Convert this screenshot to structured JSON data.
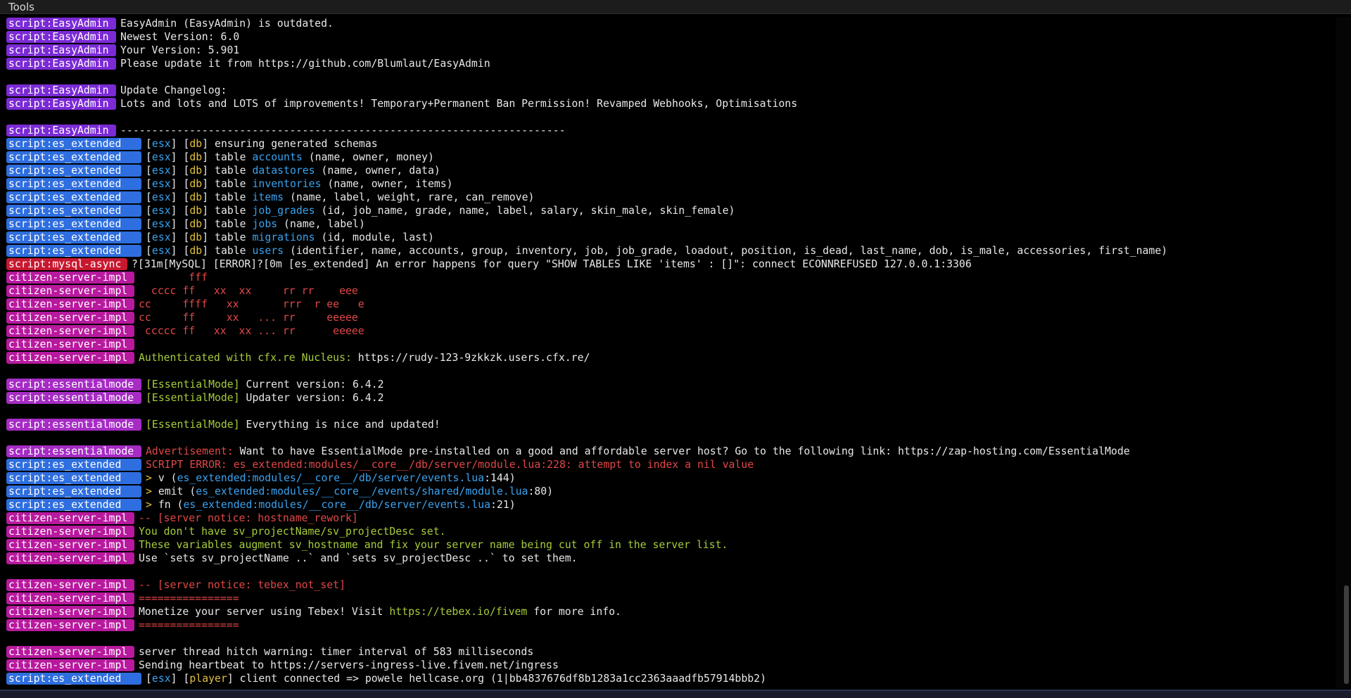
{
  "menubar": {
    "tools_label": "Tools"
  },
  "colors": {
    "tag_easyadmin": "#7b2ad6",
    "tag_es_extended": "#2e6ee0",
    "tag_mysql": "#c81830",
    "tag_citizen": "#b8199e",
    "tag_essentialmode": "#a62cc4",
    "cyan": "#3aa3f0",
    "yellow": "#e2c13d",
    "green": "#a6cc3a",
    "red": "#e24747"
  },
  "console_lines": [
    {
      "tag": "script:EasyAdmin",
      "tagColor": "p",
      "segments": [
        [
          "EasyAdmin (EasyAdmin) is outdated.",
          "w"
        ]
      ]
    },
    {
      "tag": "script:EasyAdmin",
      "tagColor": "p",
      "segments": [
        [
          "Newest Version: 6.0",
          "w"
        ]
      ]
    },
    {
      "tag": "script:EasyAdmin",
      "tagColor": "p",
      "segments": [
        [
          "Your Version: 5.901",
          "w"
        ]
      ]
    },
    {
      "tag": "script:EasyAdmin",
      "tagColor": "p",
      "segments": [
        [
          "Please update it from https://github.com/Blumlaut/EasyAdmin",
          "w"
        ]
      ]
    },
    {
      "blank": true
    },
    {
      "tag": "script:EasyAdmin",
      "tagColor": "p",
      "segments": [
        [
          "Update Changelog:",
          "w"
        ]
      ]
    },
    {
      "tag": "script:EasyAdmin",
      "tagColor": "p",
      "segments": [
        [
          "Lots and lots and LOTS of improvements! Temporary+Permanent Ban Permission! Revamped Webhooks, Optimisations",
          "w"
        ]
      ]
    },
    {
      "blank": true
    },
    {
      "tag": "script:EasyAdmin",
      "tagColor": "p",
      "segments": [
        [
          "-----------------------------------------------------------------------",
          "w"
        ]
      ]
    },
    {
      "tag": "script:es_extended",
      "tagColor": "b",
      "segments": [
        [
          "[",
          "w"
        ],
        [
          "esx",
          "c"
        ],
        [
          "] [",
          "w"
        ],
        [
          "db",
          "y"
        ],
        [
          "] ensuring generated schemas",
          "w"
        ]
      ]
    },
    {
      "tag": "script:es_extended",
      "tagColor": "b",
      "segments": [
        [
          "[",
          "w"
        ],
        [
          "esx",
          "c"
        ],
        [
          "] [",
          "w"
        ],
        [
          "db",
          "y"
        ],
        [
          "] table ",
          "w"
        ],
        [
          "accounts",
          "c"
        ],
        [
          " (name, owner, money)",
          "w"
        ]
      ]
    },
    {
      "tag": "script:es_extended",
      "tagColor": "b",
      "segments": [
        [
          "[",
          "w"
        ],
        [
          "esx",
          "c"
        ],
        [
          "] [",
          "w"
        ],
        [
          "db",
          "y"
        ],
        [
          "] table ",
          "w"
        ],
        [
          "datastores",
          "c"
        ],
        [
          " (name, owner, data)",
          "w"
        ]
      ]
    },
    {
      "tag": "script:es_extended",
      "tagColor": "b",
      "segments": [
        [
          "[",
          "w"
        ],
        [
          "esx",
          "c"
        ],
        [
          "] [",
          "w"
        ],
        [
          "db",
          "y"
        ],
        [
          "] table ",
          "w"
        ],
        [
          "inventories",
          "c"
        ],
        [
          " (name, owner, items)",
          "w"
        ]
      ]
    },
    {
      "tag": "script:es_extended",
      "tagColor": "b",
      "segments": [
        [
          "[",
          "w"
        ],
        [
          "esx",
          "c"
        ],
        [
          "] [",
          "w"
        ],
        [
          "db",
          "y"
        ],
        [
          "] table ",
          "w"
        ],
        [
          "items",
          "c"
        ],
        [
          " (name, label, weight, rare, can_remove)",
          "w"
        ]
      ]
    },
    {
      "tag": "script:es_extended",
      "tagColor": "b",
      "segments": [
        [
          "[",
          "w"
        ],
        [
          "esx",
          "c"
        ],
        [
          "] [",
          "w"
        ],
        [
          "db",
          "y"
        ],
        [
          "] table ",
          "w"
        ],
        [
          "job_grades",
          "c"
        ],
        [
          " (id, job_name, grade, name, label, salary, skin_male, skin_female)",
          "w"
        ]
      ]
    },
    {
      "tag": "script:es_extended",
      "tagColor": "b",
      "segments": [
        [
          "[",
          "w"
        ],
        [
          "esx",
          "c"
        ],
        [
          "] [",
          "w"
        ],
        [
          "db",
          "y"
        ],
        [
          "] table ",
          "w"
        ],
        [
          "jobs",
          "c"
        ],
        [
          " (name, label)",
          "w"
        ]
      ]
    },
    {
      "tag": "script:es_extended",
      "tagColor": "b",
      "segments": [
        [
          "[",
          "w"
        ],
        [
          "esx",
          "c"
        ],
        [
          "] [",
          "w"
        ],
        [
          "db",
          "y"
        ],
        [
          "] table ",
          "w"
        ],
        [
          "migrations",
          "c"
        ],
        [
          " (id, module, last)",
          "w"
        ]
      ]
    },
    {
      "tag": "script:es_extended",
      "tagColor": "b",
      "segments": [
        [
          "[",
          "w"
        ],
        [
          "esx",
          "c"
        ],
        [
          "] [",
          "w"
        ],
        [
          "db",
          "y"
        ],
        [
          "] table ",
          "w"
        ],
        [
          "users",
          "c"
        ],
        [
          " (identifier, name, accounts, group, inventory, job, job_grade, loadout, position, is_dead, last_name, dob, is_male, accessories, first_name)",
          "w"
        ]
      ]
    },
    {
      "tag": "script:mysql-async",
      "tagColor": "r",
      "segments": [
        [
          "?[31m[MySQL] [ERROR]?[0m [es_extended] An error happens for query \"SHOW TABLES LIKE 'items' : []\": connect ECONNREFUSED 127.0.0.1:3306",
          "w"
        ]
      ]
    },
    {
      "tag": "citizen-server-impl",
      "tagColor": "m",
      "segments": [
        [
          "        fff",
          "r"
        ]
      ]
    },
    {
      "tag": "citizen-server-impl",
      "tagColor": "m",
      "segments": [
        [
          "  cccc ff   xx  xx     rr rr    eee",
          "r"
        ]
      ]
    },
    {
      "tag": "citizen-server-impl",
      "tagColor": "m",
      "segments": [
        [
          "cc     ffff   xx       rrr  r ee   e",
          "r"
        ]
      ]
    },
    {
      "tag": "citizen-server-impl",
      "tagColor": "m",
      "segments": [
        [
          "cc     ff     xx   ... rr     eeeee",
          "r"
        ]
      ]
    },
    {
      "tag": "citizen-server-impl",
      "tagColor": "m",
      "segments": [
        [
          " ccccc ff   xx  xx ... rr      eeeee",
          "r"
        ]
      ]
    },
    {
      "tag": "citizen-server-impl",
      "tagColor": "m",
      "segments": []
    },
    {
      "tag": "citizen-server-impl",
      "tagColor": "m",
      "segments": [
        [
          "Authenticated with cfx.re Nucleus: ",
          "g"
        ],
        [
          "https://rudy-123-9zkkzk.users.cfx.re/",
          "w"
        ]
      ]
    },
    {
      "blank": true
    },
    {
      "tag": "script:essentialmode",
      "tagColor": "mp",
      "segments": [
        [
          "[EssentialMode]",
          "g"
        ],
        [
          " Current version: 6.4.2",
          "w"
        ]
      ]
    },
    {
      "tag": "script:essentialmode",
      "tagColor": "mp",
      "segments": [
        [
          "[EssentialMode]",
          "g"
        ],
        [
          " Updater version: 6.4.2",
          "w"
        ]
      ]
    },
    {
      "blank": true
    },
    {
      "tag": "script:essentialmode",
      "tagColor": "mp",
      "segments": [
        [
          "[EssentialMode]",
          "g"
        ],
        [
          " Everything is nice and updated!",
          "w"
        ]
      ]
    },
    {
      "blank": true
    },
    {
      "tag": "script:essentialmode",
      "tagColor": "mp",
      "segments": [
        [
          "Advertisement:",
          "r"
        ],
        [
          " Want to have EssentialMode pre-installed on a good and affordable server host? Go to the following link: https://zap-hosting.com/EssentialMode",
          "w"
        ]
      ]
    },
    {
      "tag": "script:es_extended",
      "tagColor": "b",
      "segments": [
        [
          "SCRIPT ERROR: es_extended:modules/__core__/db/server/module.lua:228: attempt to index a nil value",
          "r"
        ]
      ]
    },
    {
      "tag": "script:es_extended",
      "tagColor": "b",
      "segments": [
        [
          "> ",
          "y"
        ],
        [
          "v (",
          "w"
        ],
        [
          "es_extended:modules/__core__/db/server/events.lua",
          "c"
        ],
        [
          ":144)",
          "w"
        ]
      ]
    },
    {
      "tag": "script:es_extended",
      "tagColor": "b",
      "segments": [
        [
          "> ",
          "y"
        ],
        [
          "emit (",
          "w"
        ],
        [
          "es_extended:modules/__core__/events/shared/module.lua",
          "c"
        ],
        [
          ":80)",
          "w"
        ]
      ]
    },
    {
      "tag": "script:es_extended",
      "tagColor": "b",
      "segments": [
        [
          "> ",
          "y"
        ],
        [
          "fn (",
          "w"
        ],
        [
          "es_extended:modules/__core__/db/server/events.lua",
          "c"
        ],
        [
          ":21)",
          "w"
        ]
      ]
    },
    {
      "tag": "citizen-server-impl",
      "tagColor": "m",
      "segments": [
        [
          "-- [server notice: hostname_rework]",
          "r"
        ]
      ]
    },
    {
      "tag": "citizen-server-impl",
      "tagColor": "m",
      "segments": [
        [
          "You don't have sv_projectName/sv_projectDesc set.",
          "g"
        ]
      ]
    },
    {
      "tag": "citizen-server-impl",
      "tagColor": "m",
      "segments": [
        [
          "These variables augment sv_hostname and fix your server name being cut off in the server list.",
          "g"
        ]
      ]
    },
    {
      "tag": "citizen-server-impl",
      "tagColor": "m",
      "segments": [
        [
          "Use `sets sv_projectName ..` and `sets sv_projectDesc ..` to set them.",
          "w"
        ]
      ]
    },
    {
      "blank": true
    },
    {
      "tag": "citizen-server-impl",
      "tagColor": "m",
      "segments": [
        [
          "-- [server notice: tebex_not_set]",
          "r"
        ]
      ]
    },
    {
      "tag": "citizen-server-impl",
      "tagColor": "m",
      "segments": [
        [
          "================",
          "r"
        ]
      ]
    },
    {
      "tag": "citizen-server-impl",
      "tagColor": "m",
      "segments": [
        [
          "Monetize your server using Tebex! Visit ",
          "w"
        ],
        [
          "https://tebex.io/fivem",
          "g"
        ],
        [
          " for more info.",
          "w"
        ]
      ]
    },
    {
      "tag": "citizen-server-impl",
      "tagColor": "m",
      "segments": [
        [
          "================",
          "r"
        ]
      ]
    },
    {
      "blank": true
    },
    {
      "tag": "citizen-server-impl",
      "tagColor": "m",
      "segments": [
        [
          "server thread hitch warning: timer interval of 583 milliseconds",
          "w"
        ]
      ]
    },
    {
      "tag": "citizen-server-impl",
      "tagColor": "m",
      "segments": [
        [
          "Sending heartbeat to https://servers-ingress-live.fivem.net/ingress",
          "w"
        ]
      ]
    },
    {
      "tag": "script:es_extended",
      "tagColor": "b",
      "segments": [
        [
          "[",
          "w"
        ],
        [
          "esx",
          "c"
        ],
        [
          "] [",
          "w"
        ],
        [
          "player",
          "y"
        ],
        [
          "] client connected => powele hellcase.org (1|bb4837676df8b1283a1cc2363aaadfb57914bbb2)",
          "w"
        ]
      ]
    }
  ]
}
